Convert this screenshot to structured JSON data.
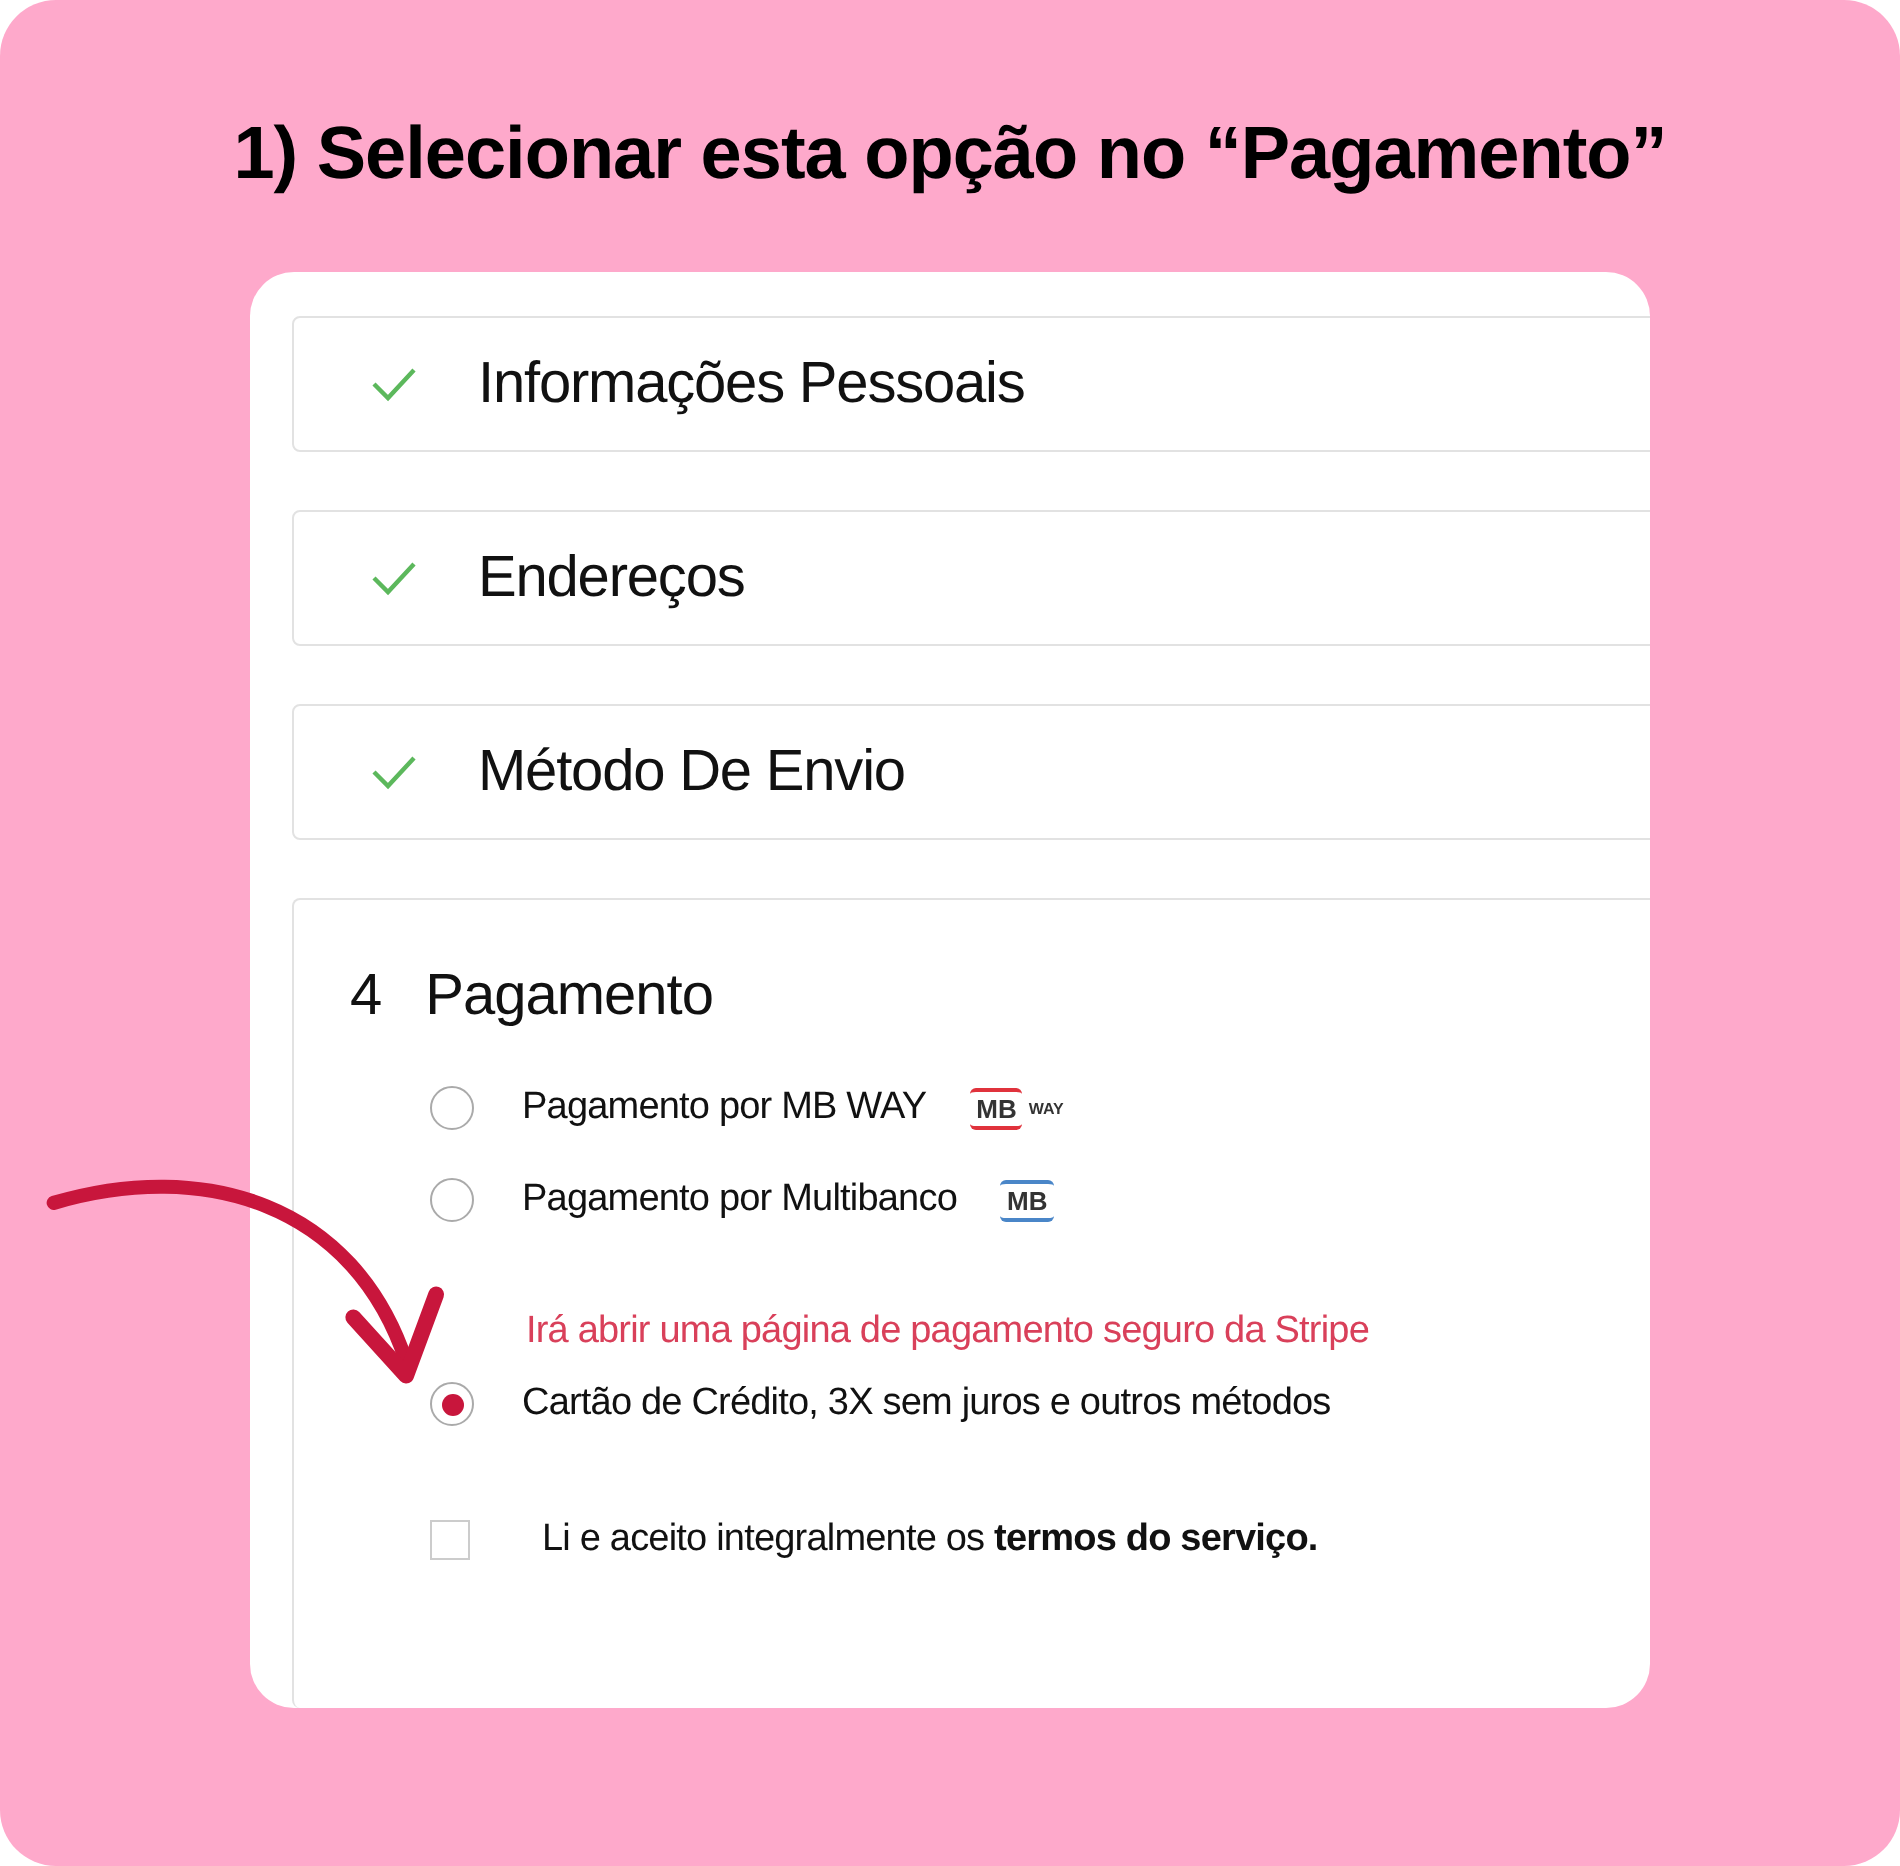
{
  "heading": "1) Selecionar esta opção no “Pagamento”",
  "steps": [
    {
      "label": "Informações Pessoais",
      "done": true
    },
    {
      "label": "Endereços",
      "done": true
    },
    {
      "label": "Método De Envio",
      "done": true
    }
  ],
  "payment": {
    "number": "4",
    "title": "Pagamento",
    "options": [
      {
        "label": "Pagamento por MB WAY",
        "selected": false,
        "logo": {
          "kind": "mbway",
          "mark": "MB",
          "suffix": "WAY"
        }
      },
      {
        "label": "Pagamento por Multibanco",
        "selected": false,
        "logo": {
          "kind": "multibanco",
          "mark": "MB"
        }
      },
      {
        "label": "Cartão de Crédito, 3X sem juros e outros métodos",
        "selected": true,
        "notice": "Irá abrir uma página de pagamento seguro da Stripe"
      }
    ],
    "terms": {
      "text": "Li e aceito integralmente os **termos do serviço.**",
      "checked": false
    }
  }
}
